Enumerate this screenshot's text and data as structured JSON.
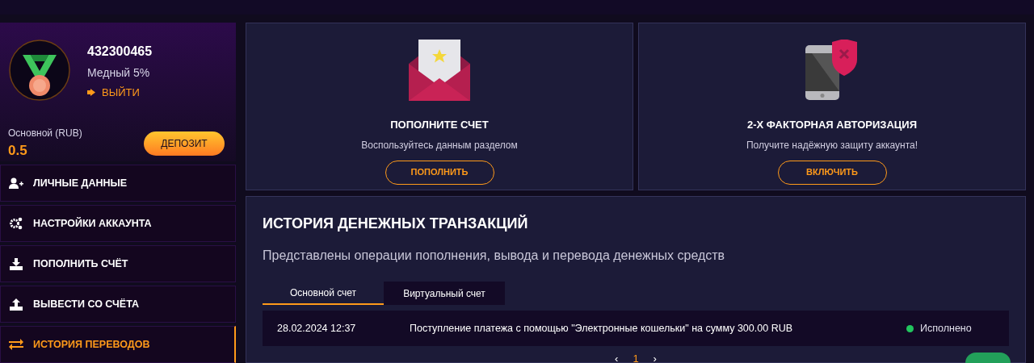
{
  "profile": {
    "account_id": "432300465",
    "level": "Медный 5%",
    "logout": "ВЫЙТИ",
    "balance_label": "Основной (RUB)",
    "balance": "0.5",
    "deposit": "ДЕПОЗИТ"
  },
  "menu": [
    {
      "kind": "user",
      "label": "ЛИЧНЫЕ ДАННЫЕ",
      "selected": false
    },
    {
      "kind": "gears",
      "label": "НАСТРОЙКИ АККАУНТА",
      "selected": false
    },
    {
      "kind": "download",
      "label": "ПОПОЛНИТЬ СЧЁТ",
      "selected": false
    },
    {
      "kind": "upload",
      "label": "ВЫВЕСТИ СО СЧЁТА",
      "selected": false
    },
    {
      "kind": "transfer",
      "label": "ИСТОРИЯ ПЕРЕВОДОВ",
      "selected": true
    }
  ],
  "cards": [
    {
      "kind": "envelope",
      "title": "ПОПОЛНИТЕ СЧЕТ",
      "text": "Воспользуйтесь данным разделом",
      "button": "ПОПОЛНИТЬ"
    },
    {
      "kind": "phone",
      "title": "2-Х ФАКТОРНАЯ АВТОРИЗАЦИЯ",
      "text": "Получите надёжную защиту аккаунта!",
      "button": "ВКЛЮЧИТЬ"
    }
  ],
  "history": {
    "title": "ИСТОРИЯ ДЕНЕЖНЫХ ТРАНЗАКЦИЙ",
    "subtitle": "Представлены операции пополнения, вывода и перевода денежных средств",
    "tabs": [
      {
        "label": "Основной счет",
        "selected": true
      },
      {
        "label": "Виртуальный счет",
        "selected": false
      }
    ],
    "rows": [
      {
        "date": "28.02.2024 12:37",
        "description": "Поступление платежа с помощью \"Электронные кошельки\" на сумму 300.00 RUB",
        "status": "Исполнено",
        "color": "#22c55e"
      }
    ],
    "pagination": {
      "prev": "‹",
      "page": "1",
      "next": "›"
    }
  }
}
